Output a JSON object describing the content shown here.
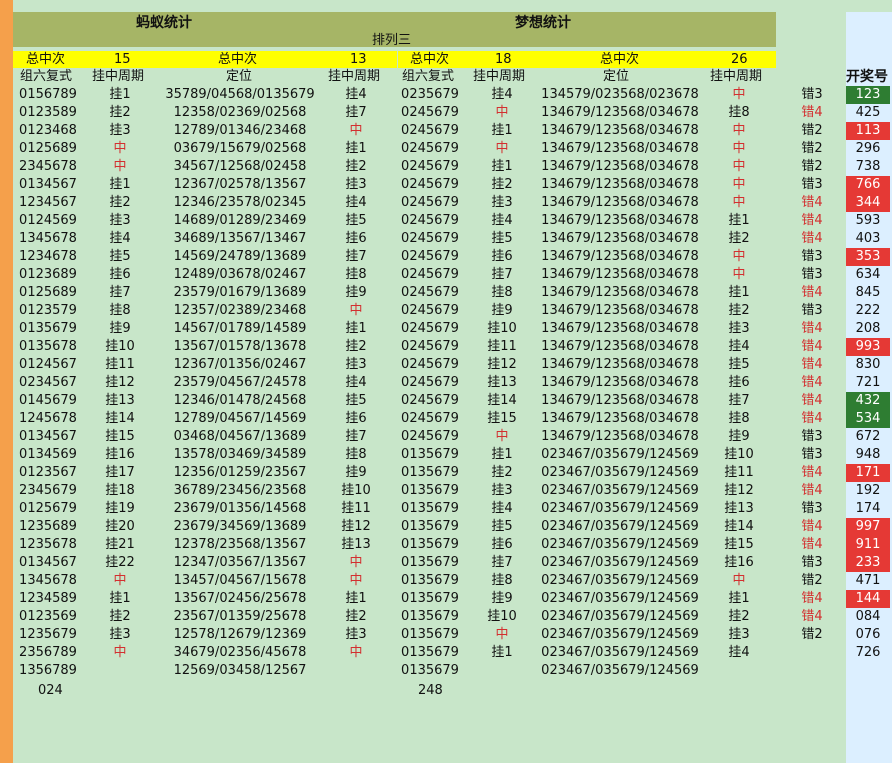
{
  "title_left": "蚂蚁统计",
  "title_right": "梦想统计",
  "subtitle": "排列三",
  "total_hits_label": "总中次",
  "totals": [
    "15",
    "13",
    "18",
    "26"
  ],
  "headers": [
    "组六复式",
    "挂中周期",
    "定位",
    "挂中周期",
    "组六复式",
    "挂中周期",
    "定位",
    "挂中周期",
    "开奖号"
  ],
  "rows": [
    [
      "0156789",
      "挂1",
      "35789/04568/0135679",
      "挂4",
      "0235679",
      "挂4",
      "134579/023568/023678",
      "中",
      "错3",
      "123"
    ],
    [
      "0123589",
      "挂2",
      "12358/02369/02568",
      "挂7",
      "0245679",
      "中",
      "134679/123568/034678",
      "挂8",
      "错4",
      "425"
    ],
    [
      "0123468",
      "挂3",
      "12789/01346/23468",
      "中",
      "0245679",
      "挂1",
      "134679/123568/034678",
      "中",
      "错2",
      "113"
    ],
    [
      "0125689",
      "中",
      "03679/15679/02568",
      "挂1",
      "0245679",
      "中",
      "134679/123568/034678",
      "中",
      "错2",
      "296"
    ],
    [
      "2345678",
      "中",
      "34567/12568/02458",
      "挂2",
      "0245679",
      "挂1",
      "134679/123568/034678",
      "中",
      "错2",
      "738"
    ],
    [
      "0134567",
      "挂1",
      "12367/02578/13567",
      "挂3",
      "0245679",
      "挂2",
      "134679/123568/034678",
      "中",
      "错3",
      "766"
    ],
    [
      "1234567",
      "挂2",
      "12346/23578/02345",
      "挂4",
      "0245679",
      "挂3",
      "134679/123568/034678",
      "中",
      "错4",
      "344"
    ],
    [
      "0124569",
      "挂3",
      "14689/01289/23469",
      "挂5",
      "0245679",
      "挂4",
      "134679/123568/034678",
      "挂1",
      "错4",
      "593"
    ],
    [
      "1345678",
      "挂4",
      "34689/13567/13467",
      "挂6",
      "0245679",
      "挂5",
      "134679/123568/034678",
      "挂2",
      "错4",
      "403"
    ],
    [
      "1234678",
      "挂5",
      "14569/24789/13689",
      "挂7",
      "0245679",
      "挂6",
      "134679/123568/034678",
      "中",
      "错3",
      "353"
    ],
    [
      "0123689",
      "挂6",
      "12489/03678/02467",
      "挂8",
      "0245679",
      "挂7",
      "134679/123568/034678",
      "中",
      "错3",
      "634"
    ],
    [
      "0125689",
      "挂7",
      "23579/01679/13689",
      "挂9",
      "0245679",
      "挂8",
      "134679/123568/034678",
      "挂1",
      "错4",
      "845"
    ],
    [
      "0123579",
      "挂8",
      "12357/02389/23468",
      "中",
      "0245679",
      "挂9",
      "134679/123568/034678",
      "挂2",
      "错3",
      "222"
    ],
    [
      "0135679",
      "挂9",
      "14567/01789/14589",
      "挂1",
      "0245679",
      "挂10",
      "134679/123568/034678",
      "挂3",
      "错4",
      "208"
    ],
    [
      "0135678",
      "挂10",
      "13567/01578/13678",
      "挂2",
      "0245679",
      "挂11",
      "134679/123568/034678",
      "挂4",
      "错4",
      "993"
    ],
    [
      "0124567",
      "挂11",
      "12367/01356/02467",
      "挂3",
      "0245679",
      "挂12",
      "134679/123568/034678",
      "挂5",
      "错4",
      "830"
    ],
    [
      "0234567",
      "挂12",
      "23579/04567/24578",
      "挂4",
      "0245679",
      "挂13",
      "134679/123568/034678",
      "挂6",
      "错4",
      "721"
    ],
    [
      "0145679",
      "挂13",
      "12346/01478/24568",
      "挂5",
      "0245679",
      "挂14",
      "134679/123568/034678",
      "挂7",
      "错4",
      "432"
    ],
    [
      "1245678",
      "挂14",
      "12789/04567/14569",
      "挂6",
      "0245679",
      "挂15",
      "134679/123568/034678",
      "挂8",
      "错4",
      "534"
    ],
    [
      "0134567",
      "挂15",
      "03468/04567/13689",
      "挂7",
      "0245679",
      "中",
      "134679/123568/034678",
      "挂9",
      "错3",
      "672"
    ],
    [
      "0134569",
      "挂16",
      "13578/03469/34589",
      "挂8",
      "0135679",
      "挂1",
      "023467/035679/124569",
      "挂10",
      "错3",
      "948"
    ],
    [
      "0123567",
      "挂17",
      "12356/01259/23567",
      "挂9",
      "0135679",
      "挂2",
      "023467/035679/124569",
      "挂11",
      "错4",
      "171"
    ],
    [
      "2345679",
      "挂18",
      "36789/23456/23568",
      "挂10",
      "0135679",
      "挂3",
      "023467/035679/124569",
      "挂12",
      "错4",
      "192"
    ],
    [
      "0125679",
      "挂19",
      "23679/01356/14568",
      "挂11",
      "0135679",
      "挂4",
      "023467/035679/124569",
      "挂13",
      "错3",
      "174"
    ],
    [
      "1235689",
      "挂20",
      "23679/34569/13689",
      "挂12",
      "0135679",
      "挂5",
      "023467/035679/124569",
      "挂14",
      "错4",
      "997"
    ],
    [
      "1235678",
      "挂21",
      "12378/23568/13567",
      "挂13",
      "0135679",
      "挂6",
      "023467/035679/124569",
      "挂15",
      "错4",
      "911"
    ],
    [
      "0134567",
      "挂22",
      "12347/03567/13567",
      "中",
      "0135679",
      "挂7",
      "023467/035679/124569",
      "挂16",
      "错3",
      "233"
    ],
    [
      "1345678",
      "中",
      "13457/04567/15678",
      "中",
      "0135679",
      "挂8",
      "023467/035679/124569",
      "中",
      "错2",
      "471"
    ],
    [
      "1234589",
      "挂1",
      "13567/02456/25678",
      "挂1",
      "0135679",
      "挂9",
      "023467/035679/124569",
      "挂1",
      "错4",
      "144"
    ],
    [
      "0123569",
      "挂2",
      "23567/01359/25678",
      "挂2",
      "0135679",
      "挂10",
      "023467/035679/124569",
      "挂2",
      "错4",
      "084"
    ],
    [
      "1235679",
      "挂3",
      "12578/12679/12369",
      "挂3",
      "0135679",
      "中",
      "023467/035679/124569",
      "挂3",
      "错2",
      "076"
    ],
    [
      "2356789",
      "中",
      "34679/02356/45678",
      "中",
      "0135679",
      "挂1",
      "023467/035679/124569",
      "挂4",
      "",
      "726"
    ],
    [
      "1356789",
      "",
      "12569/03458/12567",
      "",
      "0135679",
      "",
      "023467/035679/124569",
      "",
      "",
      ""
    ]
  ],
  "footer_left": "024",
  "footer_right": "248",
  "colors": {
    "green": "#2e7d32",
    "red": "#e53935"
  },
  "highlights": {
    "green": [
      "123",
      "432",
      "534"
    ],
    "red": [
      "113",
      "766",
      "344",
      "353",
      "993",
      "171",
      "997",
      "911",
      "233",
      "144"
    ]
  }
}
